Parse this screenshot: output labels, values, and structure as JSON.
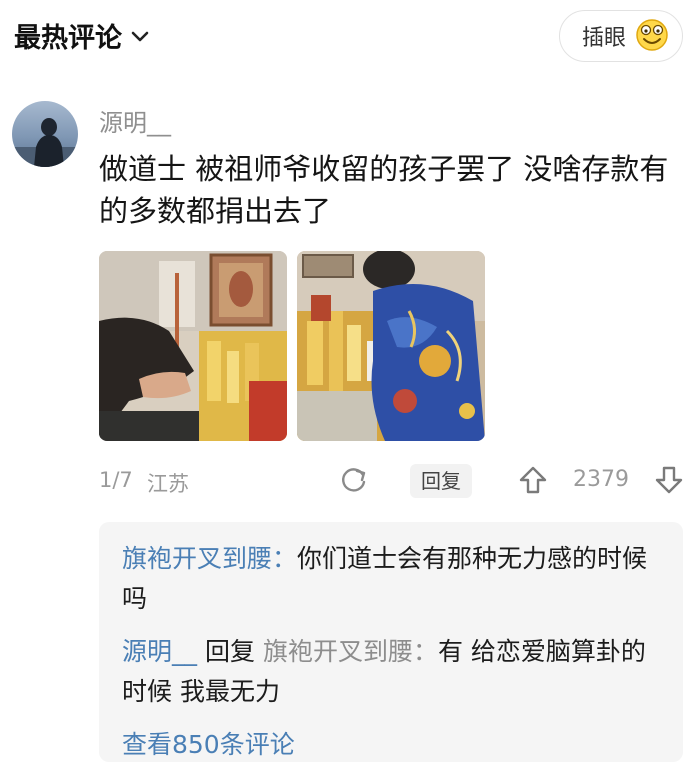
{
  "header": {
    "sort_label": "最热评论",
    "poke_label": "插眼"
  },
  "comment": {
    "username": "源明__",
    "text": "做道士 被祖师爷收留的孩子罢了 没啥存款有的多数都捐出去了",
    "image_page": "1/7",
    "location": "江苏",
    "reply_label": "回复",
    "likes": "2379"
  },
  "replies": [
    {
      "author": "旗袍开叉到腰",
      "colon": "：",
      "text": "你们道士会有那种无力感的时候吗"
    },
    {
      "author": "源明__",
      "action": "回复",
      "target": "旗袍开叉到腰",
      "colon": "：",
      "text": "有 给恋爱脑算卦的时候 我最无力"
    }
  ],
  "view_all": "查看850条评论",
  "colors": {
    "link_blue": "#4a7fb5",
    "meta_gray": "#9a9a9a",
    "reply_bg": "#f5f5f5"
  }
}
